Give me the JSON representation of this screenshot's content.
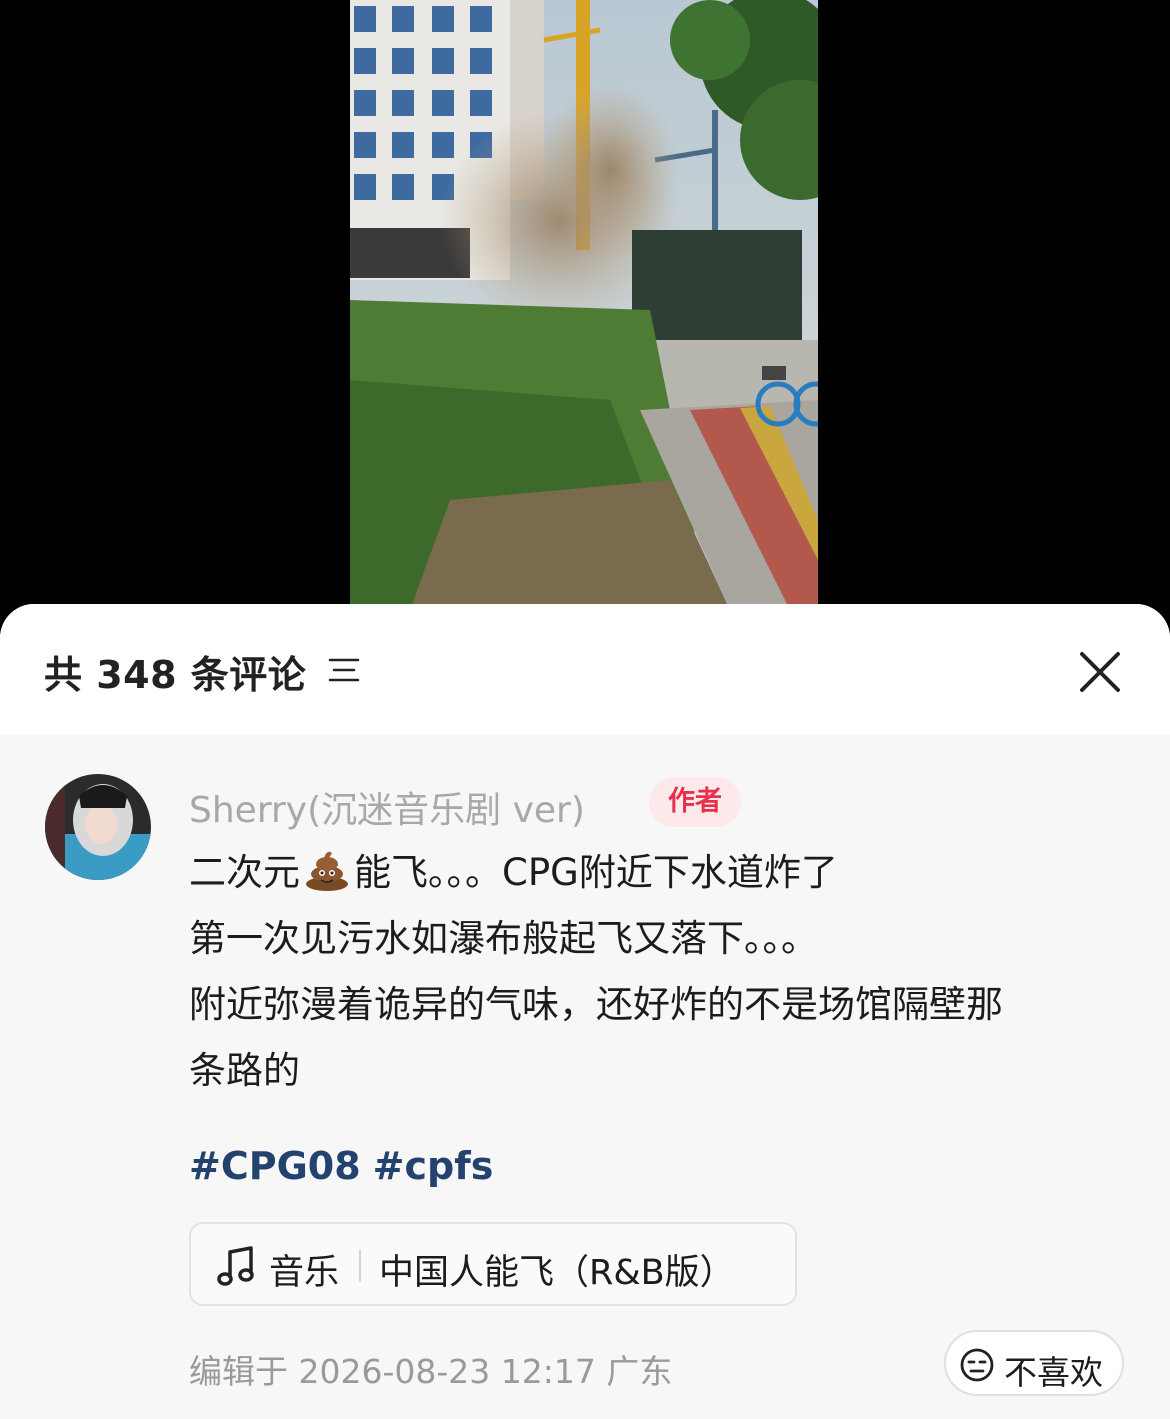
{
  "header": {
    "comment_count": "共 348 条评论",
    "filter_icon": "sort-filter-icon",
    "close_icon": "close-icon"
  },
  "comment": {
    "author_name": "Sherry(沉迷音乐剧 ver)",
    "author_badge": "作者",
    "line1_prefix": "二次元",
    "line1_emoji": "pile-of-poo-icon",
    "line1_suffix": "能飞。。。CPG附近下水道炸了",
    "line2": "第一次见污水如瀑布般起飞又落下。。。",
    "line3": "附近弥漫着诡异的气味，还好炸的不是场馆隔壁那",
    "line4": "条路的",
    "hashtags": [
      "#CPG08",
      "#cpfs"
    ],
    "music": {
      "label": "音乐",
      "title": "中国人能飞（R&B版）"
    },
    "edit_meta": "编辑于  2026-08-23 12:17 广东",
    "dislike_label": "不喜欢"
  },
  "colors": {
    "badge_text": "#e8304a",
    "badge_bg": "#fde8ea",
    "hashtag": "#23426e",
    "meta_text": "#9a9a9a"
  }
}
